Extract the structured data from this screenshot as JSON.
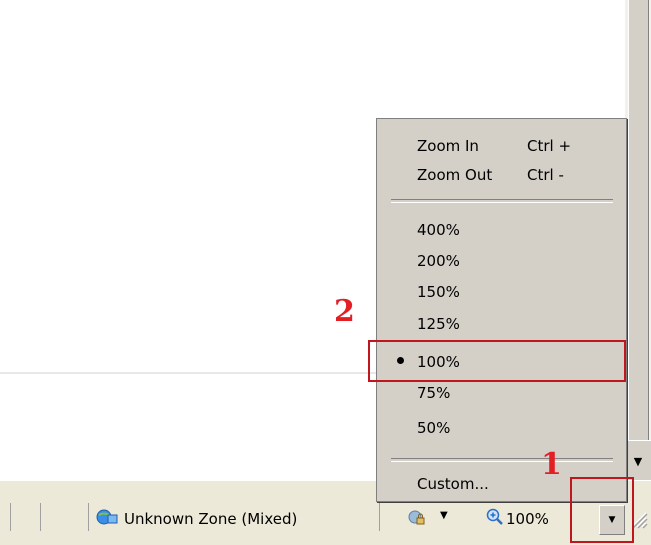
{
  "statusbar": {
    "zone_label": "Unknown Zone (Mixed)",
    "zoom_label": "100%",
    "icons": {
      "zone": "globe-network-icon",
      "protected_mode": "lock-icon",
      "zoom": "magnifier-plus-icon"
    }
  },
  "zoom_menu": {
    "zoom_in": {
      "label": "Zoom In",
      "shortcut": "Ctrl +"
    },
    "zoom_out": {
      "label": "Zoom Out",
      "shortcut": "Ctrl -"
    },
    "levels": [
      "400%",
      "200%",
      "150%",
      "125%",
      "100%",
      "75%",
      "50%"
    ],
    "selected_level": "100%",
    "custom": "Custom..."
  },
  "annotations": {
    "step1": "1",
    "step2": "2",
    "color": "#e31e24"
  }
}
